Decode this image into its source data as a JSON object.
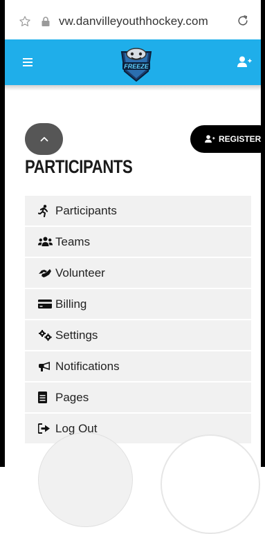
{
  "browser": {
    "url": "vw.danvilleyouthhockey.com"
  },
  "header": {
    "logo_text": "FREEZE"
  },
  "page": {
    "title": "PARTICIPANTS",
    "register_label": "REGISTER"
  },
  "nav": {
    "items": [
      {
        "label": "Participants",
        "icon": "running-icon"
      },
      {
        "label": "Teams",
        "icon": "users-icon"
      },
      {
        "label": "Volunteer",
        "icon": "handshake-icon"
      },
      {
        "label": "Billing",
        "icon": "credit-card-icon"
      },
      {
        "label": "Settings",
        "icon": "cogs-icon"
      },
      {
        "label": "Notifications",
        "icon": "bullhorn-icon"
      },
      {
        "label": "Pages",
        "icon": "file-icon"
      },
      {
        "label": "Log Out",
        "icon": "sign-out-icon"
      }
    ]
  },
  "colors": {
    "header_blue": "#1faeea",
    "menu_bg": "#f1f1f1",
    "register_bg": "#000000",
    "back_button_bg": "#565656"
  }
}
